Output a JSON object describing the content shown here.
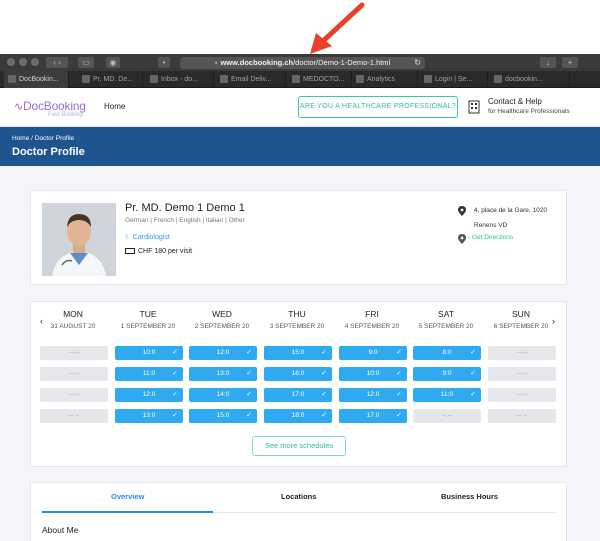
{
  "browser": {
    "url_prefix": "www.docbooking.ch",
    "url_path": "/doctor/Demo-1-Demo-1.html",
    "tabs": [
      "DocBookin...",
      "Pr. MD. De...",
      "Inbox - do...",
      "Email Deliv...",
      "MEDOCTO...",
      "Analytics",
      "Login | Se...",
      "docbookin..."
    ]
  },
  "header": {
    "logo_main": "DocBooking",
    "logo_sub": "Fast Booking",
    "nav_home": "Home",
    "hp_button": "ARE YOU A HEALTHCARE PROFESSIONAL?",
    "help_title": "Contact & Help",
    "help_sub": "for Healthcare Professionals"
  },
  "banner": {
    "crumb_home": "Home",
    "crumb_sep": "/",
    "crumb_current": "Doctor Profile",
    "title": "Doctor Profile"
  },
  "doctor": {
    "name": "Pr. MD. Demo 1 Demo 1",
    "languages": "German | French | English | Italian | Other",
    "specialty": "Cardiologist",
    "price": "CHF 180 per visit",
    "address_line1": "4, place de la Gare, 1020",
    "address_line2": "Renens VD",
    "directions": "- Get Directions"
  },
  "schedule": {
    "days": [
      {
        "name": "MON",
        "date": "31 AUGUST 20",
        "slots": [
          "--:--",
          "--:--",
          "--:--",
          "--:--"
        ]
      },
      {
        "name": "TUE",
        "date": "1 SEPTEMBER 20",
        "slots": [
          "10:0",
          "11:0",
          "12:0",
          "13:0"
        ]
      },
      {
        "name": "WED",
        "date": "2 SEPTEMBER 20",
        "slots": [
          "12:0",
          "13:0",
          "14:0",
          "15:0"
        ]
      },
      {
        "name": "THU",
        "date": "3 SEPTEMBER 20",
        "slots": [
          "15:0",
          "16:0",
          "17:0",
          "18:0"
        ]
      },
      {
        "name": "FRI",
        "date": "4 SEPTEMBER 20",
        "slots": [
          "9:0",
          "10:0",
          "12:0",
          "17:0"
        ]
      },
      {
        "name": "SAT",
        "date": "5 SEPTEMBER 20",
        "slots": [
          "8:0",
          "9:0",
          "11:0",
          "--:--"
        ]
      },
      {
        "name": "SUN",
        "date": "6 SEPTEMBER 20",
        "slots": [
          "--:--",
          "--:--",
          "--:--",
          "--:--"
        ]
      }
    ],
    "more_button": "See more schedules"
  },
  "profile_tabs": {
    "overview": "Overview",
    "locations": "Locations",
    "business_hours": "Business Hours",
    "about_heading": "About Me"
  },
  "colors": {
    "banner": "#1e5591",
    "slot_available": "#2fa9f0",
    "accent_green": "#2bbf96",
    "active_tab": "#2a8be6",
    "arrow": "#e8402a"
  }
}
